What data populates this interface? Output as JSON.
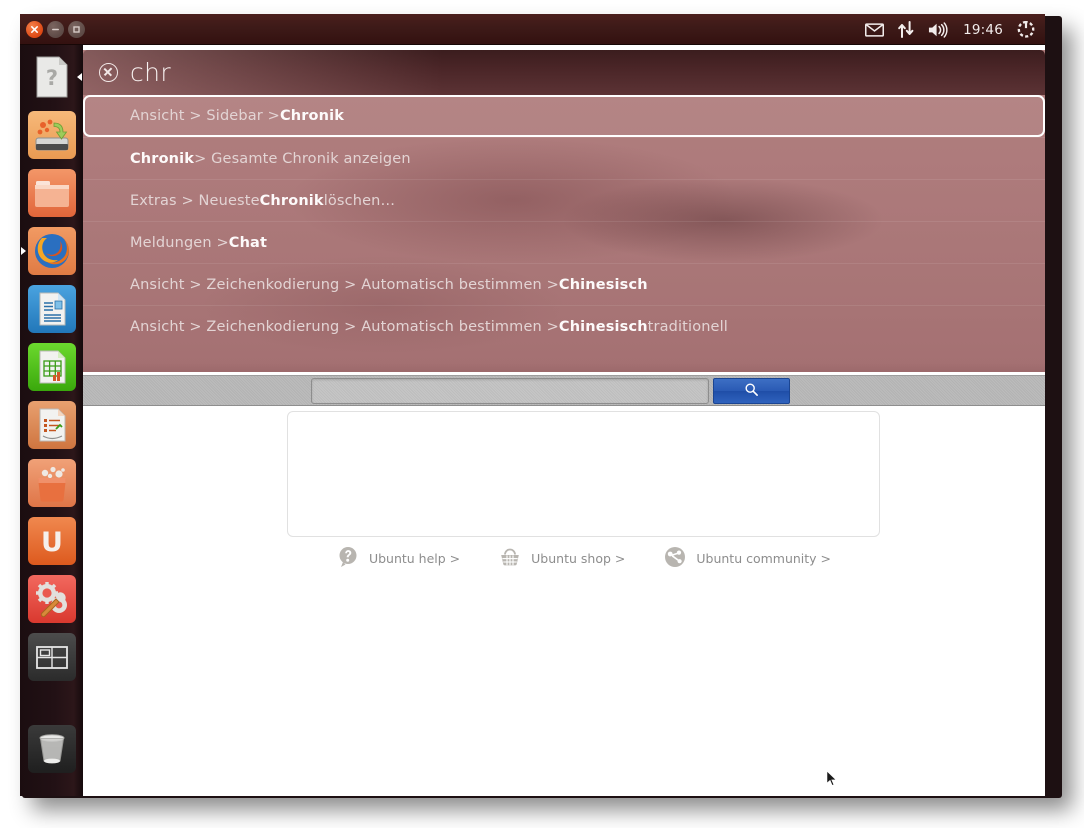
{
  "panel": {
    "clock": "19:46",
    "indicators": [
      {
        "name": "messaging-icon",
        "glyph": "envelope"
      },
      {
        "name": "network-icon",
        "glyph": "up-down-arrows"
      },
      {
        "name": "volume-icon",
        "glyph": "speaker"
      },
      {
        "name": "session-icon",
        "glyph": "power-gear"
      }
    ],
    "window_buttons": [
      {
        "name": "close-button",
        "label": "x"
      },
      {
        "name": "minimize-button",
        "label": "-"
      },
      {
        "name": "maximize-button",
        "label": "[]"
      }
    ]
  },
  "launcher": {
    "items": [
      {
        "name": "dash-home",
        "label": "Dash home",
        "icon": "dash-document-icon"
      },
      {
        "name": "backup",
        "label": "Backups",
        "icon": "backup-disk-icon"
      },
      {
        "name": "files",
        "label": "Files",
        "icon": "folder-icon"
      },
      {
        "name": "firefox",
        "label": "Firefox Web Browser",
        "icon": "firefox-icon"
      },
      {
        "name": "writer",
        "label": "LibreOffice Writer",
        "icon": "libreoffice-writer-icon"
      },
      {
        "name": "calc",
        "label": "LibreOffice Calc",
        "icon": "libreoffice-calc-icon"
      },
      {
        "name": "impress",
        "label": "LibreOffice Impress",
        "icon": "libreoffice-impress-icon"
      },
      {
        "name": "software-center",
        "label": "Ubuntu Software Center",
        "icon": "software-bag-icon"
      },
      {
        "name": "ubuntu-one",
        "label": "Ubuntu One",
        "icon": "ubuntu-one-u-icon"
      },
      {
        "name": "system-settings",
        "label": "System Settings",
        "icon": "gear-wrench-icon"
      },
      {
        "name": "workspace-switcher",
        "label": "Workspace Switcher",
        "icon": "workspace-grid-icon"
      },
      {
        "name": "trash",
        "label": "Rubbish Bin",
        "icon": "trash-icon"
      }
    ]
  },
  "hud": {
    "query": "chr",
    "clear_icon": "clear-circle-x-icon",
    "results": [
      {
        "selected": true,
        "parts": [
          {
            "text": "Ansicht > Sidebar > ",
            "bold": false
          },
          {
            "text": "Chronik",
            "bold": true
          }
        ]
      },
      {
        "selected": false,
        "parts": [
          {
            "text": "Chronik",
            "bold": true
          },
          {
            "text": " > Gesamte Chronik anzeigen",
            "bold": false
          }
        ]
      },
      {
        "selected": false,
        "parts": [
          {
            "text": "Extras > Neueste ",
            "bold": false
          },
          {
            "text": "Chronik",
            "bold": true
          },
          {
            "text": " löschen…",
            "bold": false
          }
        ]
      },
      {
        "selected": false,
        "parts": [
          {
            "text": "Meldungen > ",
            "bold": false
          },
          {
            "text": "Chat",
            "bold": true
          }
        ]
      },
      {
        "selected": false,
        "parts": [
          {
            "text": "Ansicht > Zeichenkodierung > Automatisch bestimmen > ",
            "bold": false
          },
          {
            "text": "Chinesisch",
            "bold": true
          }
        ]
      },
      {
        "selected": false,
        "parts": [
          {
            "text": "Ansicht > Zeichenkodierung > Automatisch bestimmen > ",
            "bold": false
          },
          {
            "text": "Chinesisch",
            "bold": true
          },
          {
            "text": " traditionell",
            "bold": false
          }
        ]
      }
    ]
  },
  "page": {
    "search": {
      "value": "",
      "placeholder": "",
      "button_icon": "magnifier-icon"
    },
    "links": [
      {
        "name": "ubuntu-help-link",
        "label": "Ubuntu help >",
        "icon": "question-mark-icon"
      },
      {
        "name": "ubuntu-shop-link",
        "label": "Ubuntu shop >",
        "icon": "shopping-basket-icon"
      },
      {
        "name": "ubuntu-community-link",
        "label": "Ubuntu community >",
        "icon": "community-circle-of-friends-icon"
      }
    ]
  },
  "colors": {
    "ubuntu_orange": "#dd4814",
    "panel_dark": "#3d1a18",
    "hud_rose": "#ad7a7b",
    "search_button_blue": "#2a5ab4",
    "link_gray": "#8d8d8d"
  }
}
